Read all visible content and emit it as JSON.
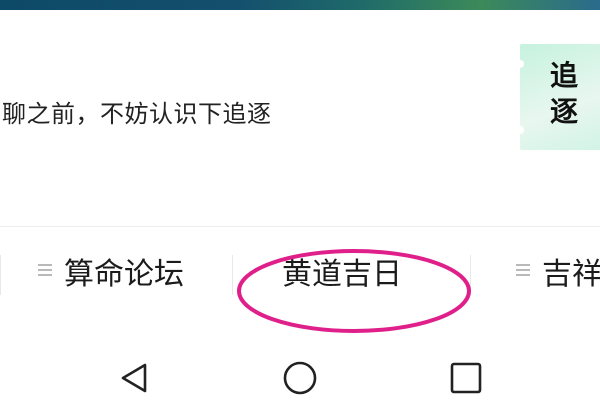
{
  "chat": {
    "message": "聊之前，不妨认识下追逐"
  },
  "promo": {
    "text": "追逐"
  },
  "tabs": [
    {
      "label": "算命论坛",
      "icon": "menu-icon"
    },
    {
      "label": "黄道吉日",
      "icon": "none",
      "highlighted": true
    },
    {
      "label": "吉祥",
      "icon": "menu-icon"
    }
  ],
  "colors": {
    "highlight": "#e0208a",
    "banner": "#14506e",
    "promo_bg": "#d2f3e6"
  },
  "nav": {
    "back_icon": "triangle-back-icon",
    "home_icon": "circle-home-icon",
    "recents_icon": "square-recents-icon"
  }
}
